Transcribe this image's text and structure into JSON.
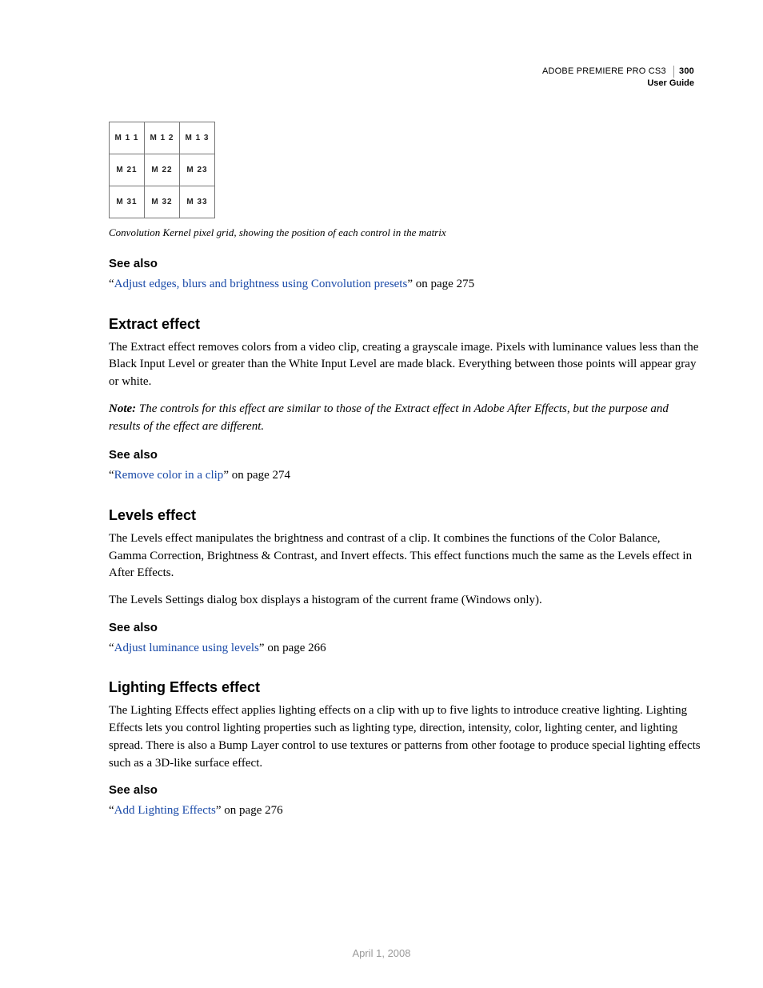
{
  "header": {
    "product": "ADOBE PREMIERE PRO CS3",
    "page_number": "300",
    "guide": "User Guide"
  },
  "kernel": {
    "rows": [
      [
        "M 1 1",
        "M 1 2",
        "M 1 3"
      ],
      [
        "M 21",
        "M 22",
        "M 23"
      ],
      [
        "M 31",
        "M 32",
        "M 33"
      ]
    ],
    "caption": "Convolution Kernel pixel grid, showing the position of each control in the matrix"
  },
  "seealso_label": "See also",
  "quote_open": "“",
  "quote_close": "”",
  "sections": {
    "conv_ref": {
      "link": "Adjust edges, blurs and brightness using Convolution presets",
      "suffix": " on page 275"
    },
    "extract": {
      "title": "Extract effect",
      "body": "The Extract effect removes colors from a video clip, creating a grayscale image. Pixels with luminance values less than the Black Input Level or greater than the White Input Level are made black. Everything between those points will appear gray or white.",
      "note_label": "Note:",
      "note_text": " The controls for this effect are similar to those of the Extract effect in Adobe After Effects, but the purpose and results of the effect are different.",
      "ref": {
        "link": "Remove color in a clip",
        "suffix": " on page 274"
      }
    },
    "levels": {
      "title": "Levels effect",
      "body1": "The Levels effect manipulates the brightness and contrast of a clip. It combines the functions of the Color Balance, Gamma Correction, Brightness & Contrast, and Invert effects. This effect functions much the same as the Levels effect in After Effects.",
      "body2": "The Levels Settings dialog box displays a histogram of the current frame (Windows only).",
      "ref": {
        "link": "Adjust luminance using levels",
        "suffix": " on page 266"
      }
    },
    "lighting": {
      "title": "Lighting Effects effect",
      "body": "The Lighting Effects effect applies lighting effects on a clip with up to five lights to introduce creative lighting. Lighting Effects lets you control lighting properties such as lighting type, direction, intensity, color, lighting center, and lighting spread. There is also a Bump Layer control to use textures or patterns from other footage to produce special lighting effects such as a 3D-like surface effect.",
      "ref": {
        "link": "Add Lighting Effects",
        "suffix": " on page 276"
      }
    }
  },
  "footer_date": "April 1, 2008"
}
